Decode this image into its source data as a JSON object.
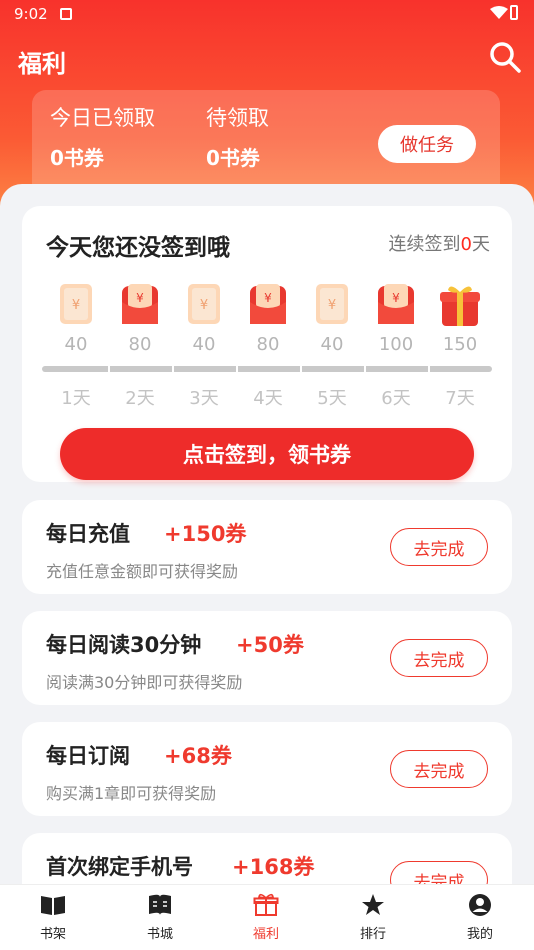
{
  "status_bar": {
    "time": "9:02"
  },
  "header": {
    "title": "福利"
  },
  "coupons": {
    "claimed_label": "今日已领取",
    "claimed_value": "0书券",
    "pending_label": "待领取",
    "pending_value": "0书券",
    "task_button": "做任务"
  },
  "checkin": {
    "title": "今天您还没签到哦",
    "streak_prefix": "连续签到",
    "streak_days": "0",
    "streak_suffix": "天",
    "button_label": "点击签到，领书券",
    "days": [
      {
        "label": "1天",
        "points": "40",
        "icon": "coupon-ticket-icon"
      },
      {
        "label": "2天",
        "points": "80",
        "icon": "red-envelope-icon"
      },
      {
        "label": "3天",
        "points": "40",
        "icon": "coupon-ticket-icon"
      },
      {
        "label": "4天",
        "points": "80",
        "icon": "red-envelope-icon"
      },
      {
        "label": "5天",
        "points": "40",
        "icon": "coupon-ticket-icon"
      },
      {
        "label": "6天",
        "points": "100",
        "icon": "red-envelope-icon"
      },
      {
        "label": "7天",
        "points": "150",
        "icon": "gift-box-icon"
      }
    ]
  },
  "tasks": [
    {
      "title": "每日充值",
      "reward": "+150券",
      "desc": "充值任意金额即可获得奖励",
      "button": "去完成"
    },
    {
      "title": "每日阅读30分钟",
      "reward": "+50券",
      "desc": "阅读满30分钟即可获得奖励",
      "button": "去完成"
    },
    {
      "title": "每日订阅",
      "reward": "+68券",
      "desc": "购买满1章即可获得奖励",
      "button": "去完成"
    },
    {
      "title": "首次绑定手机号",
      "reward": "+168券",
      "desc": "",
      "button": "去完成"
    }
  ],
  "tabs": [
    {
      "label": "书架",
      "icon": "open-book-icon",
      "active": false
    },
    {
      "label": "书城",
      "icon": "book-icon",
      "active": false
    },
    {
      "label": "福利",
      "icon": "gift-icon",
      "active": true
    },
    {
      "label": "排行",
      "icon": "star-icon",
      "active": false
    },
    {
      "label": "我的",
      "icon": "user-icon",
      "active": false
    }
  ],
  "colors": {
    "accent": "#ef3a2e",
    "hero_top": "#f8322c",
    "hero_bottom": "#fd9a4e"
  }
}
